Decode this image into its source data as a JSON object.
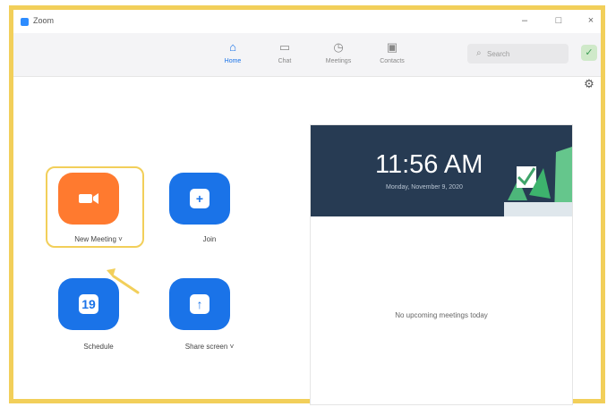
{
  "app": {
    "title": "Zoom"
  },
  "window_controls": {
    "minimize": "–",
    "maximize": "□",
    "close": "×"
  },
  "nav": [
    {
      "label": "Home",
      "icon": "home-icon"
    },
    {
      "label": "Chat",
      "icon": "chat-icon"
    },
    {
      "label": "Meetings",
      "icon": "clock-icon"
    },
    {
      "label": "Contacts",
      "icon": "contacts-icon"
    }
  ],
  "search": {
    "placeholder": "Search"
  },
  "actions": {
    "new_meeting_label": "New Meeting",
    "join_label": "Join",
    "schedule_label": "Schedule",
    "share_screen_label": "Share screen",
    "calendar_day": "19",
    "plus_glyph": "+",
    "arrow_glyph": "↑"
  },
  "right_panel": {
    "time": "11:56 AM",
    "date": "Monday, November 9, 2020",
    "no_upcoming": "No upcoming meetings today"
  },
  "colors": {
    "accent_blue": "#1a73e8",
    "orange": "#ff7a2f",
    "highlight_yellow": "#f2cf5a",
    "banner_dark": "#273b53"
  }
}
